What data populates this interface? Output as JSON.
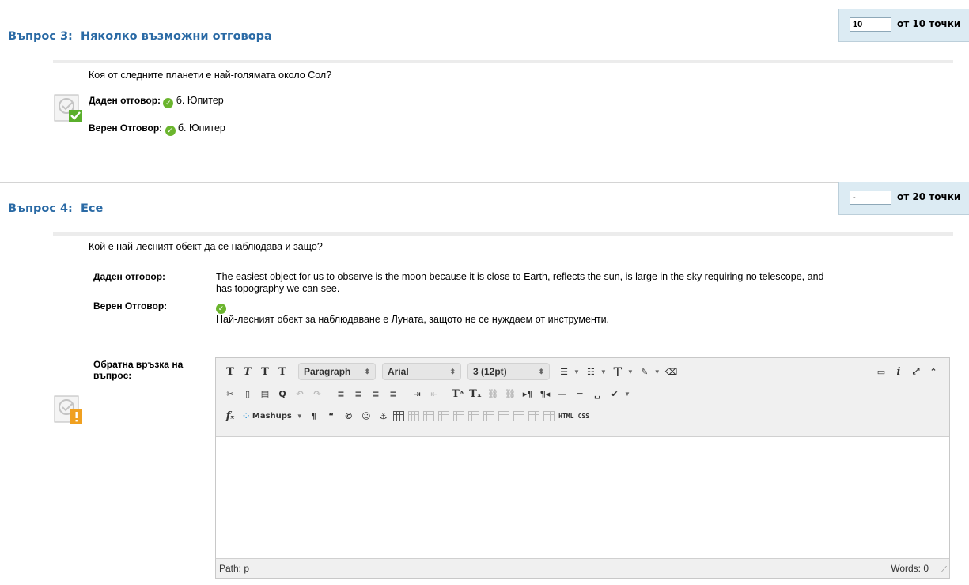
{
  "question3": {
    "title_prefix": "Въпрос 3:",
    "title": "Няколко възможни отговора",
    "points_value": "10",
    "points_label": "от 10 точки",
    "question_text": "Коя от следните планети е най-голямата около Сол?",
    "given_label": "Даден отговор:",
    "given_answer": "б. Юпитер",
    "correct_label": "Верен Отговор:",
    "correct_answer": "б. Юпитер"
  },
  "question4": {
    "title_prefix": "Въпрос 4:",
    "title": "Есе",
    "points_value": "-",
    "points_label": "от 20 точки",
    "question_text": "Кой е най-лесният обект да се наблюдава и защо?",
    "given_label": "Даден отговор:",
    "given_answer_line1": "The easiest object for us to observe is the moon because it is close to Earth, reflects the sun, is large in the sky requiring no telescope, and",
    "given_answer_line2": "has topography we can see.",
    "correct_label": "Верен Отговор:",
    "correct_answer": "Най-лесният обект за наблюдаване е Луната, защото не се нуждаем от инструменти.",
    "feedback_label_line1": "Обратна връзка на",
    "feedback_label_line2": "въпрос:"
  },
  "editor": {
    "paragraph_select": "Paragraph",
    "font_select": "Arial",
    "size_select": "3 (12pt)",
    "mashups_label": "Mashups",
    "html_label": "HTML",
    "css_label": "CSS",
    "path_label": "Path: p",
    "words_label": "Words: 0",
    "icons": [
      "bold-icon",
      "italic-icon",
      "underline-icon",
      "strikethrough-icon",
      "unordered-list-icon",
      "ordered-list-icon",
      "text-color-icon",
      "highlight-icon",
      "eraser-icon",
      "preview-icon",
      "info-icon",
      "fullscreen-icon",
      "collapse-icon",
      "cut-icon",
      "copy-icon",
      "paste-icon",
      "find-icon",
      "undo-icon",
      "redo-icon",
      "align-left-icon",
      "align-center-icon",
      "align-right-icon",
      "justify-icon",
      "indent-icon",
      "outdent-icon",
      "superscript-icon",
      "subscript-icon",
      "link-icon",
      "unlink-icon",
      "ltr-icon",
      "rtl-icon",
      "hr-icon",
      "nbsp-icon",
      "spellcheck-icon",
      "formula-icon",
      "pilcrow-icon",
      "quote-icon",
      "copyright-icon",
      "emoticon-icon",
      "anchor-icon",
      "table-icon",
      "resize-icon"
    ],
    "colors": {
      "accent": "#2a6aa5",
      "check": "#6bb52e",
      "warning": "#f0a020",
      "points_bg": "#dcebf3"
    }
  }
}
